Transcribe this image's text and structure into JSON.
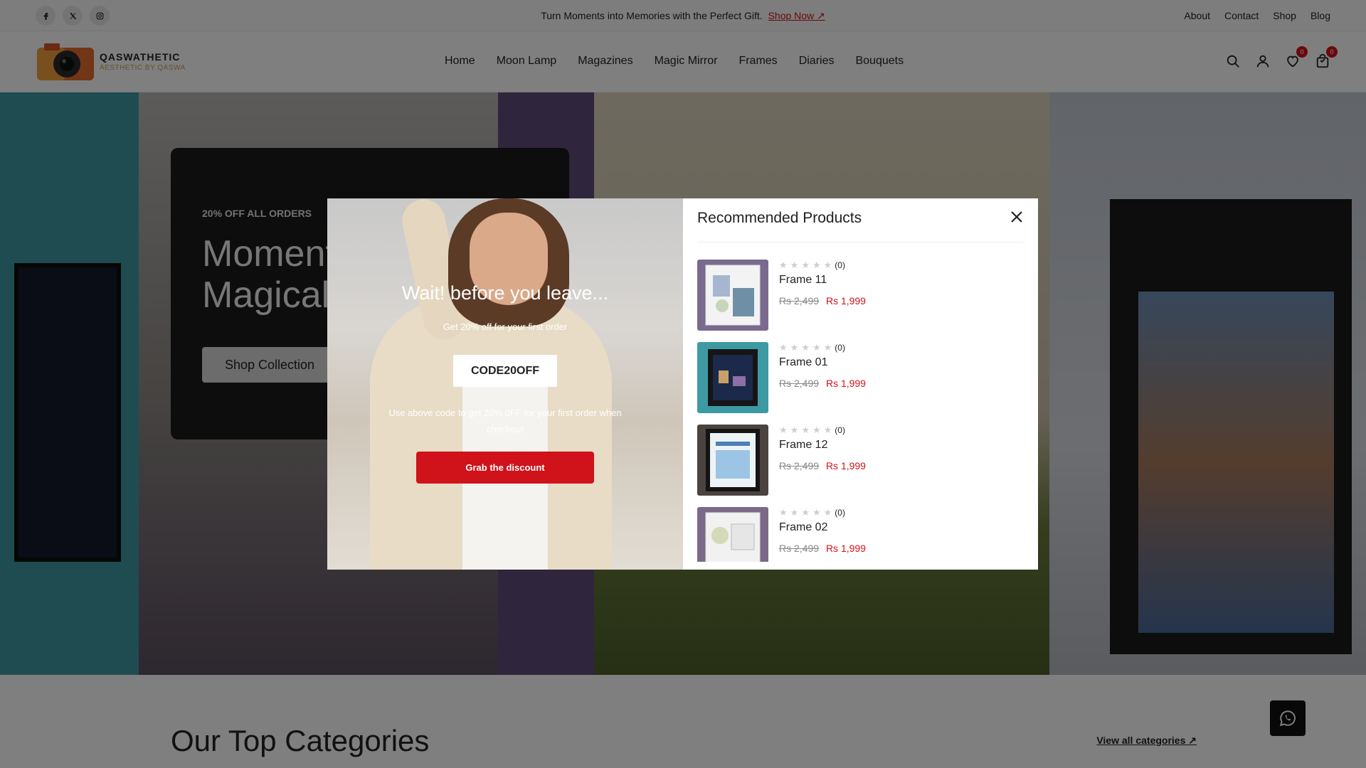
{
  "topbar": {
    "social": [
      {
        "icon": "facebook-icon"
      },
      {
        "icon": "x-twitter-icon"
      },
      {
        "icon": "instagram-icon"
      }
    ],
    "announcement": "Turn Moments into Memories with the Perfect Gift.",
    "announcement_link": "Shop Now",
    "links": [
      "About",
      "Contact",
      "Shop",
      "Blog"
    ]
  },
  "header": {
    "logo_name": "QASWATHETIC",
    "logo_tagline": "AESTHETIC BY QASWA",
    "nav": [
      "Home",
      "Moon Lamp",
      "Magazines",
      "Magic Mirror",
      "Frames",
      "Diaries",
      "Bouquets"
    ],
    "wishlist_count": "0",
    "cart_count": "0"
  },
  "hero": {
    "eyebrow": "20% OFF ALL ORDERS",
    "title_line1": "Moment",
    "title_line2": "Magical",
    "cta": "Shop Collection"
  },
  "categories": {
    "title": "Our Top Categories",
    "link": "View all categories"
  },
  "popup": {
    "title": "Wait! before you leave...",
    "subtitle": "Get 20% off for your first order",
    "code": "CODE20OFF",
    "note": "Use above code to get 20% 0FF for your first order when checkout",
    "button": "Grab the discount"
  },
  "recommended": {
    "title": "Recommended Products",
    "items": [
      {
        "name": "Frame 11",
        "reviews": "(0)",
        "old_price": "Rs 2,499",
        "price": "Rs 1,999"
      },
      {
        "name": "Frame 01",
        "reviews": "(0)",
        "old_price": "Rs 2,499",
        "price": "Rs 1,999"
      },
      {
        "name": "Frame 12",
        "reviews": "(0)",
        "old_price": "Rs 2,499",
        "price": "Rs 1,999"
      },
      {
        "name": "Frame 02",
        "reviews": "(0)",
        "old_price": "Rs 2,499",
        "price": "Rs 1,999"
      }
    ]
  },
  "colors": {
    "accent": "#d0121a",
    "dark": "#222222"
  }
}
